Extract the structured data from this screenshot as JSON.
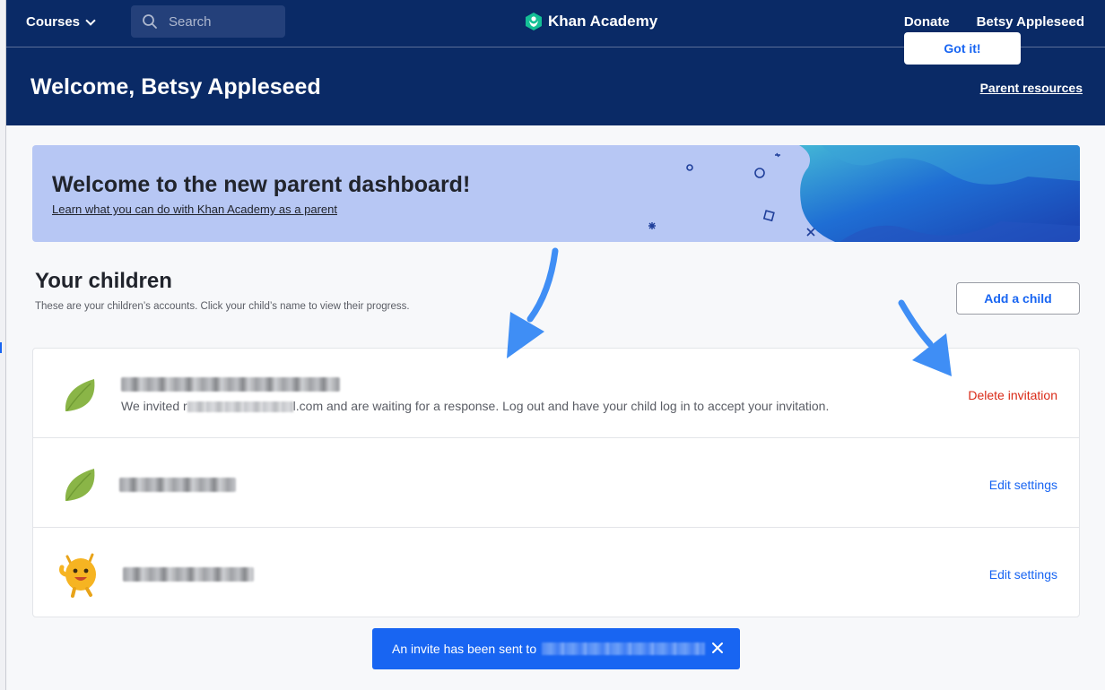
{
  "nav": {
    "courses_label": "Courses",
    "search_placeholder": "Search",
    "logo_text": "Khan Academy",
    "donate_label": "Donate",
    "user_name": "Betsy Appleseed"
  },
  "header": {
    "welcome": "Welcome, Betsy Appleseed",
    "parent_resources": "Parent resources"
  },
  "banner": {
    "title": "Welcome to the new parent dashboard!",
    "link": "Learn what you can do with Khan Academy as a parent",
    "button": "Got it!"
  },
  "children": {
    "title": "Your children",
    "subtitle": "These are your children’s accounts. Click your child’s name to view their progress.",
    "add_button": "Add a child",
    "rows": [
      {
        "avatar": "leaf-avatar-icon",
        "invite_prefix": "We invited r",
        "invite_suffix": "l.com and are waiting for a response. Log out and have your child log in to accept your invitation.",
        "action": "Delete invitation"
      },
      {
        "avatar": "leaf-avatar-icon",
        "action": "Edit settings"
      },
      {
        "avatar": "monster-avatar-icon",
        "action": "Edit settings"
      }
    ]
  },
  "toast": {
    "text": "An invite has been sent to"
  },
  "colors": {
    "nav_bg": "#0a2a66",
    "accent": "#1865f2",
    "danger": "#d92916",
    "banner_bg": "#b7c7f4"
  }
}
